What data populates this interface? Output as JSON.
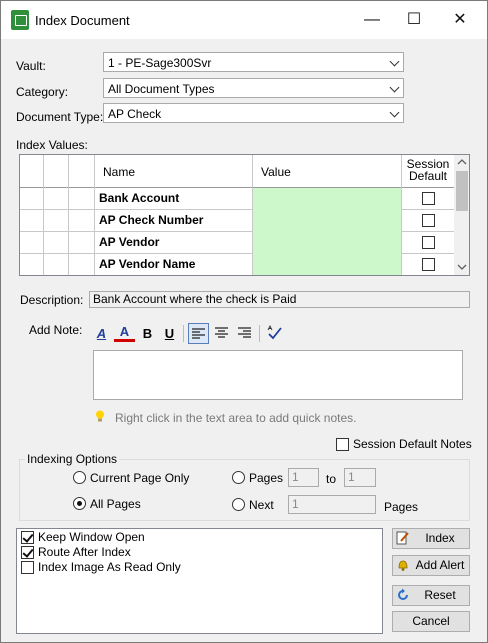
{
  "window": {
    "title": "Index Document",
    "controls": {
      "minimize": "—",
      "maximize": "☐",
      "close": "✕"
    }
  },
  "fields": {
    "vault": {
      "label": "Vault:",
      "value": "1 - PE-Sage300Svr"
    },
    "category": {
      "label": "Category:",
      "value": "All Document Types"
    },
    "document_type": {
      "label": "Document Type:",
      "value": "AP Check"
    }
  },
  "index_values": {
    "label": "Index Values:",
    "columns": {
      "name": "Name",
      "value": "Value",
      "session_default": "Session\nDefault"
    },
    "rows": [
      {
        "name": "Bank Account",
        "value": "",
        "session_default": false
      },
      {
        "name": "AP Check Number",
        "value": "",
        "session_default": false
      },
      {
        "name": "AP Vendor",
        "value": "",
        "session_default": false
      },
      {
        "name": "AP Vendor Name",
        "value": "",
        "session_default": false
      }
    ]
  },
  "description": {
    "label": "Description:",
    "value": "Bank Account where the check is Paid"
  },
  "note": {
    "label": "Add Note:",
    "value": "",
    "toolbar": {
      "font_glyph": "A",
      "color_glyph": "A",
      "bold_glyph": "B",
      "underline_glyph": "U"
    },
    "hint": "Right click in the text area to add quick notes.",
    "session_default_label": "Session Default Notes",
    "session_default_checked": false
  },
  "indexing_options": {
    "label": "Indexing Options",
    "current_page_only": {
      "label": "Current Page Only",
      "selected": false
    },
    "all_pages": {
      "label": "All Pages",
      "selected": true
    },
    "pages": {
      "label": "Pages",
      "from": "1",
      "to_label": "to",
      "to": "1",
      "selected": false
    },
    "next": {
      "label": "Next",
      "value": "1",
      "suffix": "Pages",
      "selected": false
    }
  },
  "options": [
    {
      "label": "Keep Window Open",
      "checked": true
    },
    {
      "label": "Route After Index",
      "checked": true
    },
    {
      "label": "Index Image As Read Only",
      "checked": false
    }
  ],
  "buttons": {
    "index": "Index",
    "add_alert": "Add Alert",
    "reset": "Reset",
    "cancel": "Cancel"
  },
  "colors": {
    "value_cell_bg": "#ccf8cc",
    "app_icon": "#2f8f3a",
    "color_underline": "#d00000",
    "font_icon": "#1f3f9a"
  }
}
